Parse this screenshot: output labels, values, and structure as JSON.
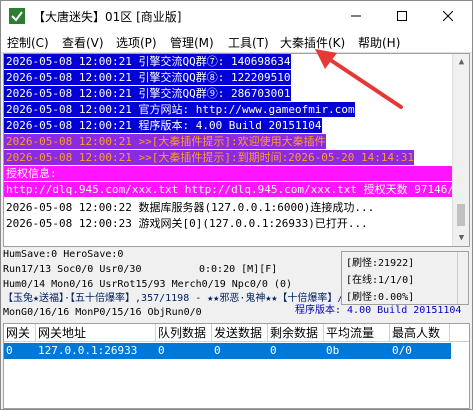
{
  "window": {
    "title": "【大唐迷失】01区 [商业版]"
  },
  "menu": [
    {
      "label": "控制(C)"
    },
    {
      "label": "查看(V)"
    },
    {
      "label": "选项(P)"
    },
    {
      "label": "管理(M)"
    },
    {
      "label": "工具(T)"
    },
    {
      "label": "大秦插件(K)"
    },
    {
      "label": "帮助(H)"
    }
  ],
  "log": [
    {
      "text": "2026-05-08 12:00:21 引擎交流QQ群⑦: 140698634",
      "style": "blue"
    },
    {
      "text": "2026-05-08 12:00:21 引擎交流QQ群⑧: 122209510",
      "style": "blue"
    },
    {
      "text": "2026-05-08 12:00:21 引擎交流QQ群⑨: 286703001",
      "style": "blue"
    },
    {
      "text": "2026-05-08 12:00:21 官方网站: http://www.gameofmir.com",
      "style": "blue"
    },
    {
      "text": "2026-05-08 12:00:21 程序版本: 4.00 Build 20151104",
      "style": "blue"
    },
    {
      "text": "2026-05-08 12:00:21 >>[大秦插件提示]:欢迎使用大秦插件",
      "style": "purple"
    },
    {
      "text": "2026-05-08 12:00:21 >>[大秦插件提示]:到期时间:2026-05-20 14:14:31",
      "style": "purple"
    },
    {
      "text": "授权信息:",
      "style": "pink"
    },
    {
      "text": "http://dlq.945.com/xxx.txt http://dlq.945.com/xxx.txt 授权天数 97146/99999",
      "style": "pink"
    },
    {
      "text": "2026-05-08 12:00:22 数据库服务器(127.0.0.1:6000)连接成功...",
      "style": "plain"
    },
    {
      "text": "2026-05-08 12:00:23 游戏网关[0](127.0.0.1:26933)已打开...",
      "style": "plain"
    }
  ],
  "stats": {
    "line1": "HumSave:0 HeroSave:0",
    "line2": "Run17/13 Soc0/0 Usr0/30",
    "timer": "0:0:20 [M][F]",
    "line3": "Hum0/14 Mon0/16 UsrRot15/93 Merch0/19 Npc0/0 (0)",
    "line4": "【玉兔★送福】·【五十倍爆率】,357/1198 - ★★邪恶·鬼神★★【十倍爆率】/266/33",
    "line5": "MonG0/16/16 MonP0/15/16 ObjRun0/0",
    "version": "程序版本: 4.00 Build 20151104"
  },
  "side": {
    "refresh": "[刷怪:21922]",
    "online": "[在线:1/1/0]",
    "rate": "[刷怪:0.00%]"
  },
  "table": {
    "headers": [
      "网关",
      "网关地址",
      "队列数据",
      "发送数据",
      "剩余数据",
      "平均流量",
      "最高人数"
    ],
    "rows": [
      [
        "0",
        "127.0.0.1:26933",
        "0",
        "0",
        "0",
        "0b",
        "0/0"
      ]
    ]
  },
  "colors": {
    "log_blue": "#0000d6",
    "log_purple": "#8a2be2",
    "log_pink": "#ff14ff",
    "selection": "#0078d7",
    "annotation_arrow": "#e53935"
  }
}
